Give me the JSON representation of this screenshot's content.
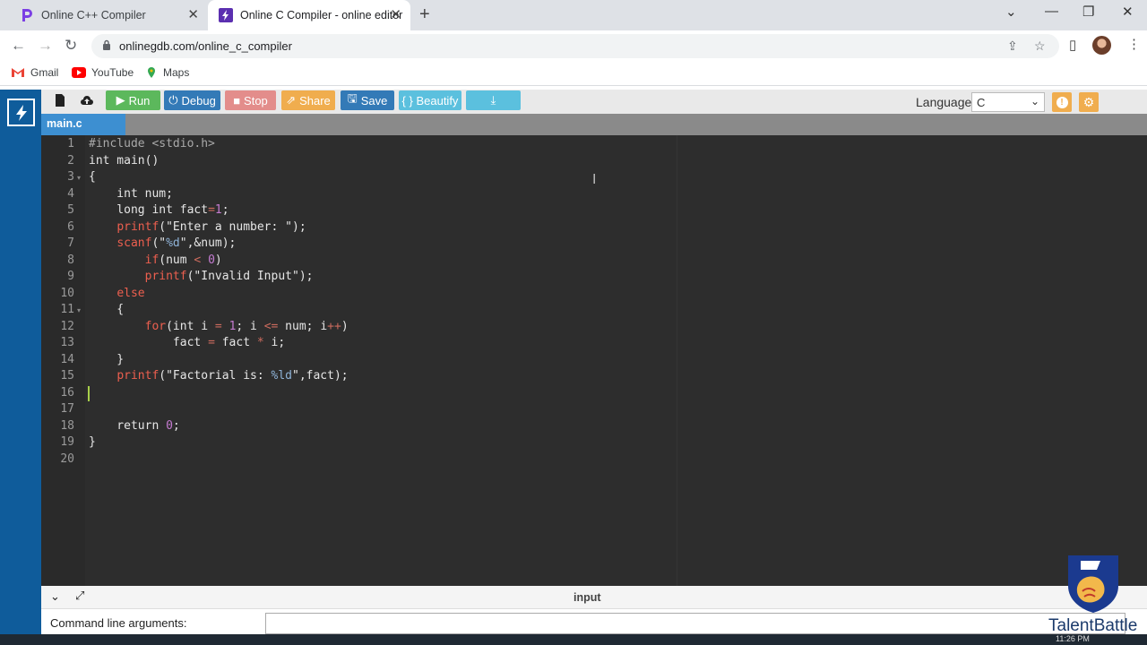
{
  "browser": {
    "tabs": [
      {
        "title": "Online C++ Compiler",
        "active": false
      },
      {
        "title": "Online C Compiler - online editor",
        "active": true
      }
    ],
    "url": "onlinegdb.com/online_c_compiler",
    "bookmarks": [
      {
        "label": "Gmail"
      },
      {
        "label": "YouTube"
      },
      {
        "label": "Maps"
      }
    ]
  },
  "toolbar": {
    "run": "Run",
    "debug": "Debug",
    "stop": "Stop",
    "share": "Share",
    "save": "Save",
    "beautify": "{ } Beautify",
    "language_label": "Language",
    "language_value": "C",
    "colors": {
      "run": "#5cb85c",
      "debug": "#337ab7",
      "stop": "#d9534f",
      "share": "#f0ad4e",
      "save": "#337ab7",
      "beautify": "#5bc0de",
      "download": "#5bc0de"
    }
  },
  "file_tab": "main.c",
  "editor": {
    "lines": [
      {
        "n": "1",
        "fold": ""
      },
      {
        "n": "2",
        "fold": ""
      },
      {
        "n": "3",
        "fold": "▾"
      },
      {
        "n": "4",
        "fold": ""
      },
      {
        "n": "5",
        "fold": ""
      },
      {
        "n": "6",
        "fold": ""
      },
      {
        "n": "7",
        "fold": ""
      },
      {
        "n": "8",
        "fold": ""
      },
      {
        "n": "9",
        "fold": ""
      },
      {
        "n": "10",
        "fold": ""
      },
      {
        "n": "11",
        "fold": "▾"
      },
      {
        "n": "12",
        "fold": ""
      },
      {
        "n": "13",
        "fold": ""
      },
      {
        "n": "14",
        "fold": ""
      },
      {
        "n": "15",
        "fold": ""
      },
      {
        "n": "16",
        "fold": ""
      },
      {
        "n": "17",
        "fold": ""
      },
      {
        "n": "18",
        "fold": ""
      },
      {
        "n": "19",
        "fold": ""
      },
      {
        "n": "20",
        "fold": ""
      }
    ],
    "code": [
      [
        {
          "t": "#include <stdio.h>",
          "c": "pp"
        }
      ],
      [
        {
          "t": "int main()",
          "c": "kw"
        }
      ],
      [
        {
          "t": "{",
          "c": "kw"
        }
      ],
      [
        {
          "t": "    int num;",
          "c": "kw"
        }
      ],
      [
        {
          "t": "    long int fact",
          "c": "kw"
        },
        {
          "t": "=",
          "c": "op"
        },
        {
          "t": "1",
          "c": "num"
        },
        {
          "t": ";",
          "c": "kw"
        }
      ],
      [
        {
          "t": "    ",
          "c": "kw"
        },
        {
          "t": "printf",
          "c": "fn"
        },
        {
          "t": "(\"Enter a number: \");",
          "c": "str"
        }
      ],
      [
        {
          "t": "    ",
          "c": "kw"
        },
        {
          "t": "scanf",
          "c": "fn"
        },
        {
          "t": "(\"",
          "c": "str"
        },
        {
          "t": "%d",
          "c": "fmt"
        },
        {
          "t": "\",&num);",
          "c": "str"
        }
      ],
      [
        {
          "t": "        ",
          "c": "kw"
        },
        {
          "t": "if",
          "c": "ctl"
        },
        {
          "t": "(num ",
          "c": "kw"
        },
        {
          "t": "<",
          "c": "op"
        },
        {
          "t": " ",
          "c": "kw"
        },
        {
          "t": "0",
          "c": "num"
        },
        {
          "t": ")",
          "c": "kw"
        }
      ],
      [
        {
          "t": "        ",
          "c": "kw"
        },
        {
          "t": "printf",
          "c": "fn"
        },
        {
          "t": "(\"Invalid Input\");",
          "c": "str"
        }
      ],
      [
        {
          "t": "    ",
          "c": "kw"
        },
        {
          "t": "else",
          "c": "ctl"
        }
      ],
      [
        {
          "t": "    {",
          "c": "kw"
        }
      ],
      [
        {
          "t": "        ",
          "c": "kw"
        },
        {
          "t": "for",
          "c": "ctl"
        },
        {
          "t": "(int i ",
          "c": "kw"
        },
        {
          "t": "=",
          "c": "op"
        },
        {
          "t": " ",
          "c": "kw"
        },
        {
          "t": "1",
          "c": "num"
        },
        {
          "t": "; i ",
          "c": "kw"
        },
        {
          "t": "<=",
          "c": "op"
        },
        {
          "t": " num; i",
          "c": "kw"
        },
        {
          "t": "++",
          "c": "op"
        },
        {
          "t": ")",
          "c": "kw"
        }
      ],
      [
        {
          "t": "            fact ",
          "c": "kw"
        },
        {
          "t": "=",
          "c": "op"
        },
        {
          "t": " fact ",
          "c": "kw"
        },
        {
          "t": "*",
          "c": "op"
        },
        {
          "t": " i;",
          "c": "kw"
        }
      ],
      [
        {
          "t": "    }",
          "c": "kw"
        }
      ],
      [
        {
          "t": "    ",
          "c": "kw"
        },
        {
          "t": "printf",
          "c": "fn"
        },
        {
          "t": "(\"Factorial is: ",
          "c": "str"
        },
        {
          "t": "%ld",
          "c": "fmt"
        },
        {
          "t": "\",fact);",
          "c": "str"
        }
      ],
      [
        {
          "t": "",
          "c": "kw"
        }
      ],
      [
        {
          "t": "",
          "c": "kw"
        }
      ],
      [
        {
          "t": "    return ",
          "c": "kw"
        },
        {
          "t": "0",
          "c": "num"
        },
        {
          "t": ";",
          "c": "kw"
        }
      ],
      [
        {
          "t": "}",
          "c": "kw"
        }
      ],
      [
        {
          "t": "",
          "c": "kw"
        }
      ]
    ],
    "cursor_line": 16
  },
  "input_panel": {
    "title": "input",
    "cmd_label": "Command line arguments:",
    "cmd_value": ""
  },
  "watermark": "TalentBattle",
  "clock": "11:26 PM"
}
